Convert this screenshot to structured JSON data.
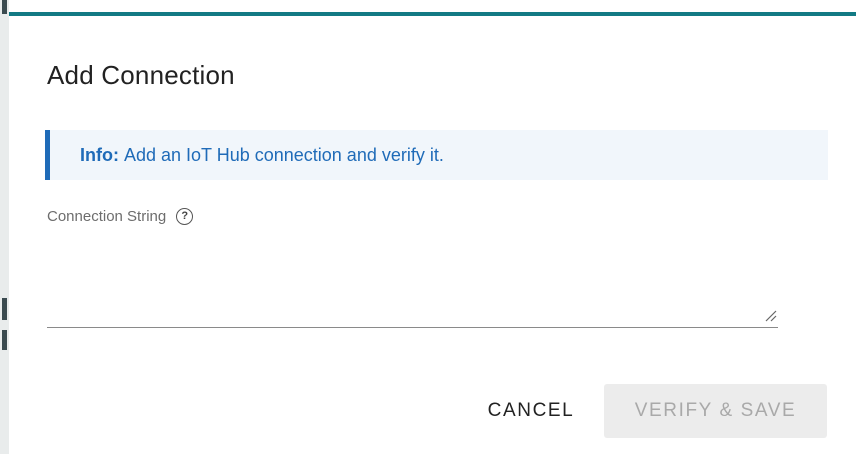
{
  "dialog": {
    "title": "Add Connection",
    "accent_color": "#127a84"
  },
  "info": {
    "label": "Info:",
    "message": "Add an IoT Hub connection and verify it.",
    "color": "#1f6bb8"
  },
  "connection_string": {
    "label": "Connection String",
    "help_icon": "question-circle-icon",
    "value": ""
  },
  "actions": {
    "cancel_label": "CANCEL",
    "verify_save_label": "VERIFY & SAVE",
    "verify_save_disabled": true
  }
}
